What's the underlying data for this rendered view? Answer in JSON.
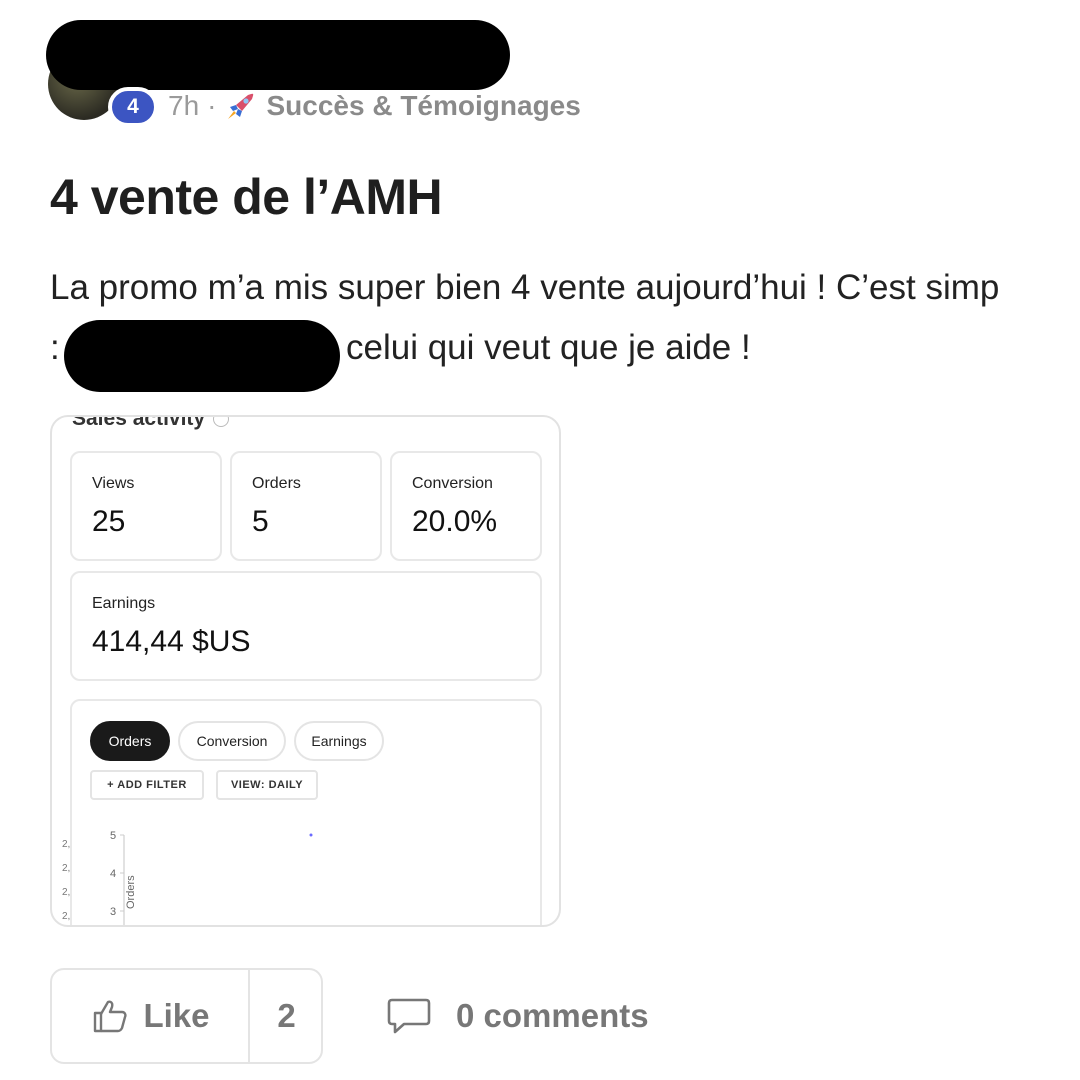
{
  "post": {
    "author_level": "4",
    "time": "7h",
    "separator": "·",
    "category": "Succès & Témoignages",
    "category_icon": "rocket-icon",
    "title": "4 vente de l’AMH",
    "body_line1": "La promo m’a mis super bien 4 vente aujourd’hui ! C’est simp",
    "body_line2_prefix": ":",
    "body_line2_rest": "celui qui veut que je aide !"
  },
  "attachment": {
    "title": "Sales activity",
    "stats": {
      "views_label": "Views",
      "views_value": "25",
      "orders_label": "Orders",
      "orders_value": "5",
      "conversion_label": "Conversion",
      "conversion_value": "20.0%",
      "earnings_label": "Earnings",
      "earnings_value": "414,44 $US"
    },
    "tabs": [
      "Orders",
      "Conversion",
      "Earnings"
    ],
    "active_tab": "Orders",
    "add_filter": "+ ADD FILTER",
    "view_daily": "VIEW: DAILY",
    "chart_data": {
      "type": "scatter",
      "ylabel": "Orders",
      "y_ticks": [
        "5",
        "4",
        "3"
      ],
      "left_ticks": [
        "2,",
        "2,",
        "2,",
        "2,"
      ]
    }
  },
  "actions": {
    "like_label": "Like",
    "like_count": "2",
    "comments_label": "0 comments"
  },
  "colors": {
    "badge": "#3c55c2",
    "active_pill": "#1a1a1a",
    "muted": "#777777"
  }
}
